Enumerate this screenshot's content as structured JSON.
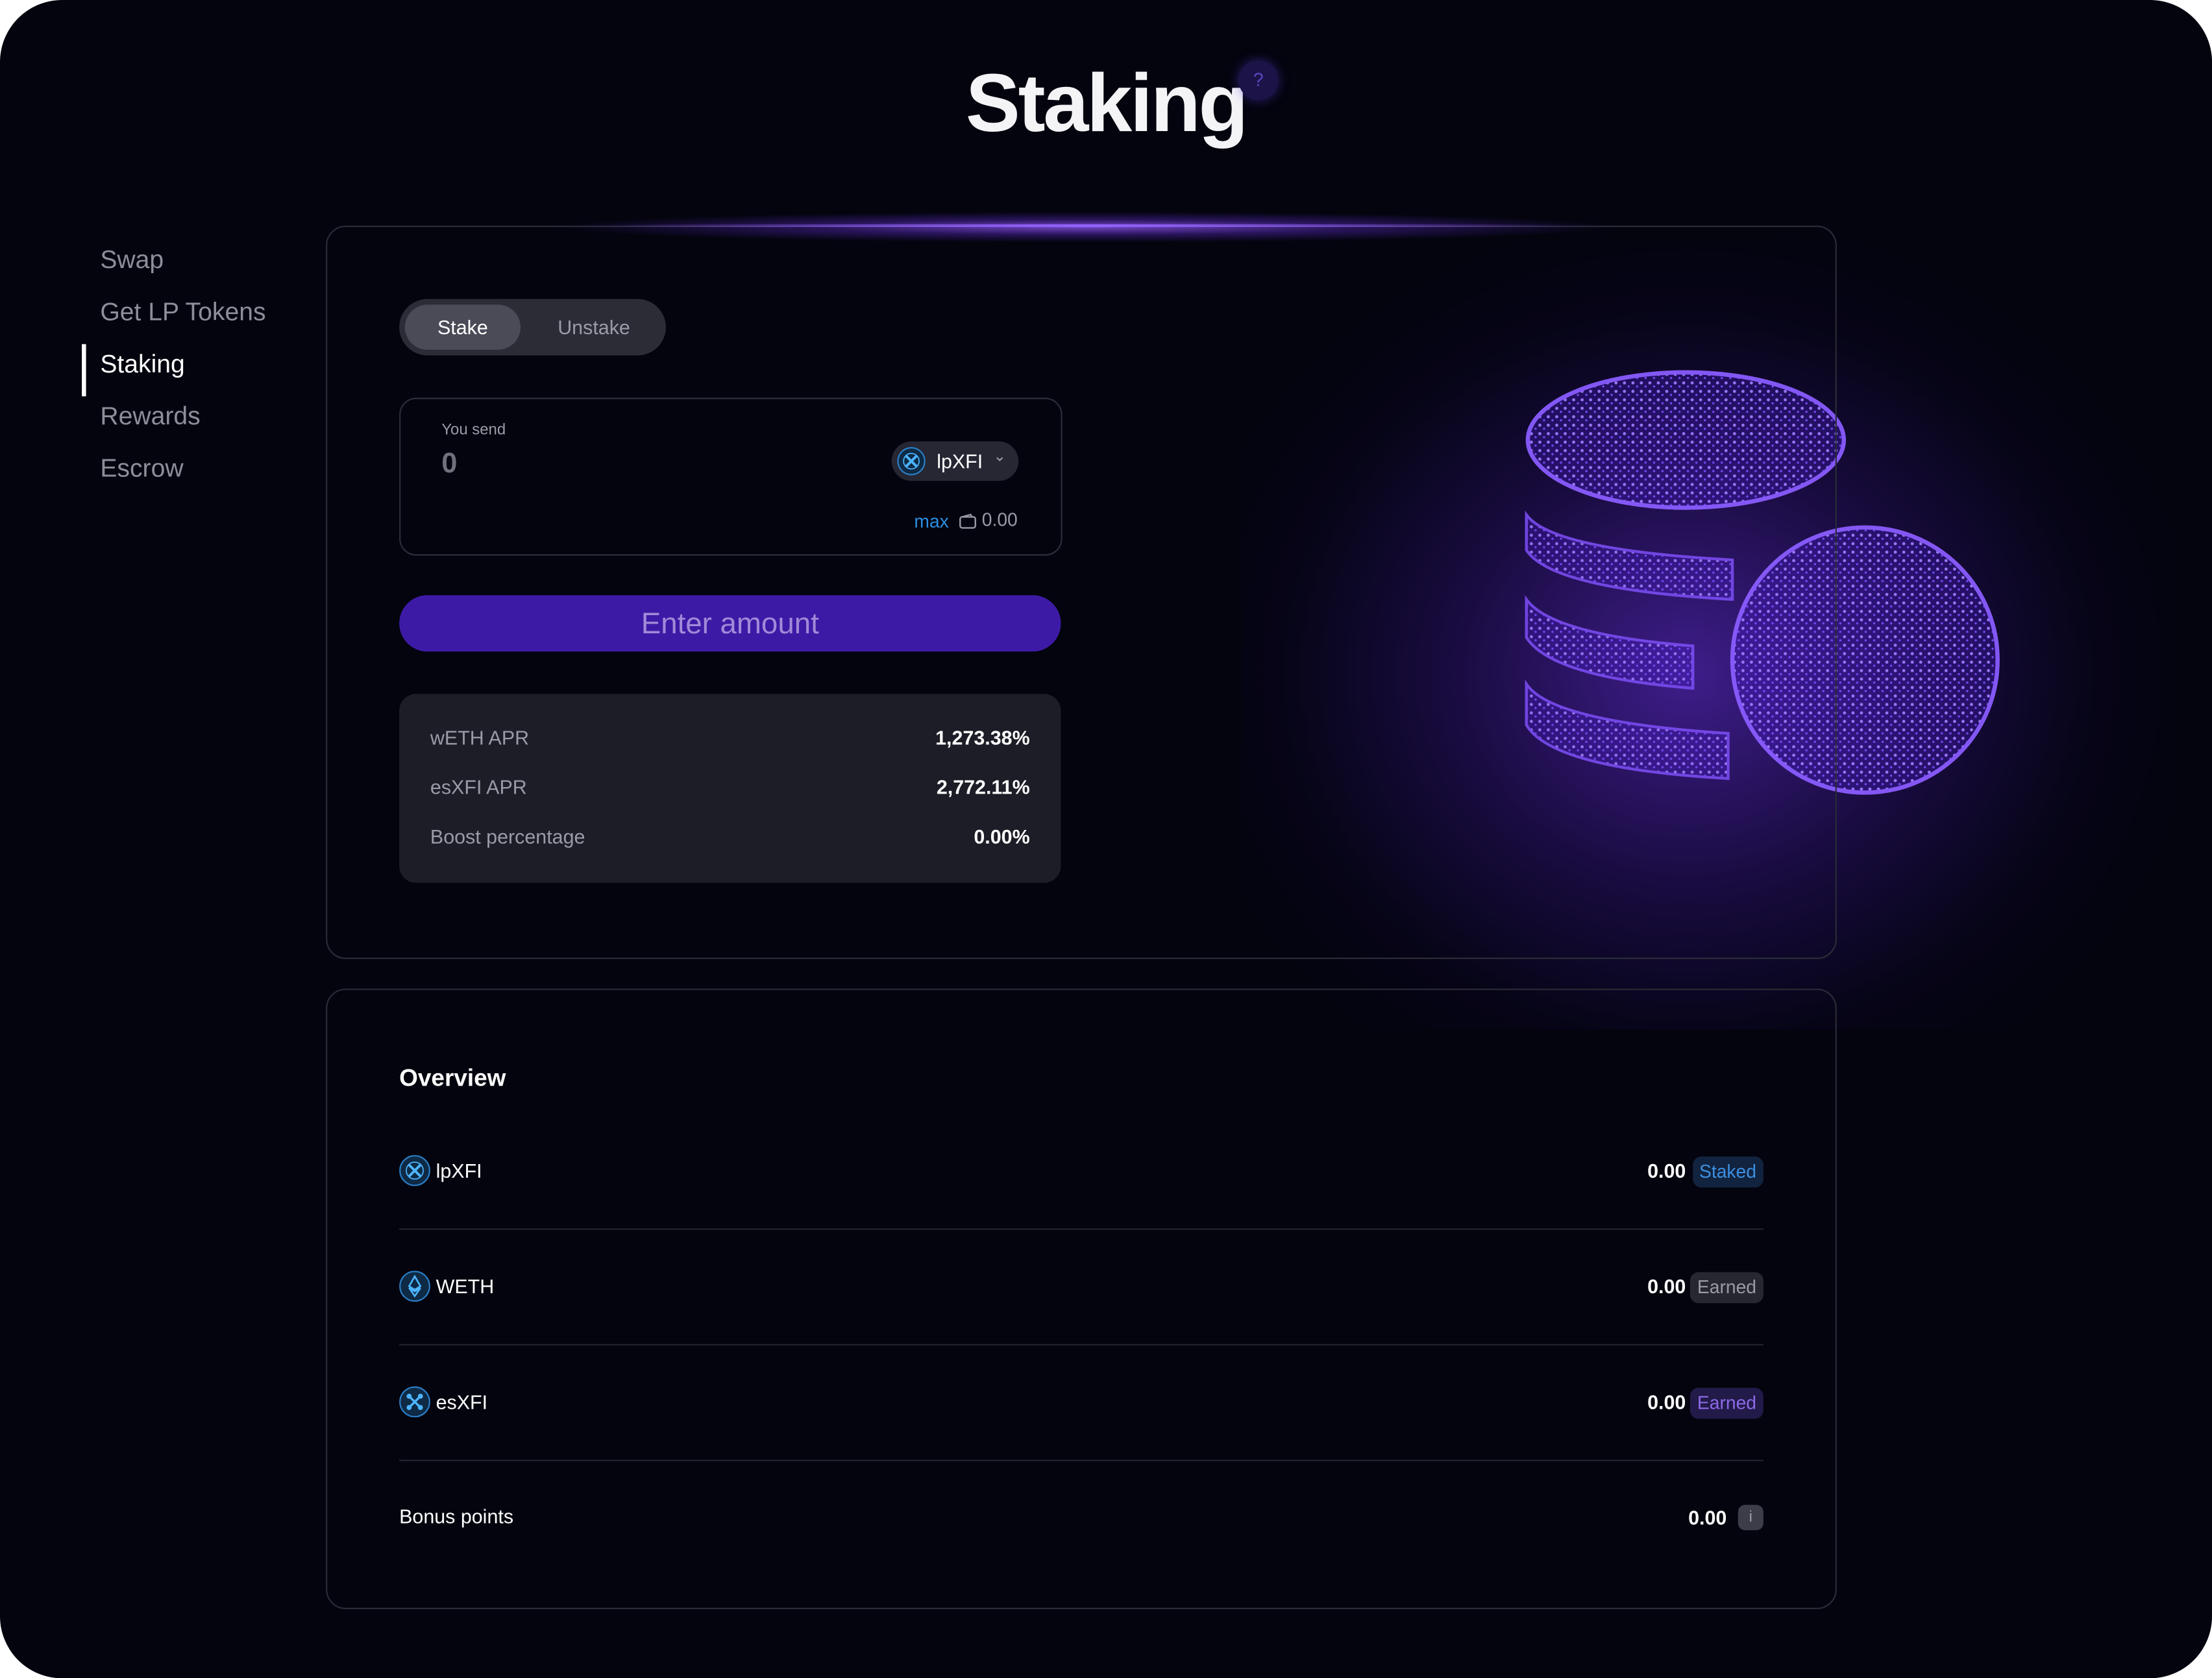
{
  "page": {
    "title": "Staking",
    "help_icon": "?"
  },
  "sidebar": {
    "items": [
      {
        "label": "Swap"
      },
      {
        "label": "Get LP Tokens"
      },
      {
        "label": "Staking",
        "active": true
      },
      {
        "label": "Rewards"
      },
      {
        "label": "Escrow"
      }
    ]
  },
  "stake_panel": {
    "tabs": {
      "stake": "Stake",
      "unstake": "Unstake",
      "selected": "Stake"
    },
    "send": {
      "label": "You send",
      "value": "",
      "placeholder": "0",
      "token": "lpXFI",
      "max_label": "max",
      "balance": "0.00"
    },
    "submit_label": "Enter amount",
    "stats": [
      {
        "label": "wETH APR",
        "value": "1,273.38%"
      },
      {
        "label": "esXFI APR",
        "value": "2,772.11%"
      },
      {
        "label": "Boost percentage",
        "value": "0.00%"
      }
    ]
  },
  "overview": {
    "title": "Overview",
    "rows": [
      {
        "token": "lpXFI",
        "amount": "0.00",
        "badge": "Staked"
      },
      {
        "token": "WETH",
        "amount": "0.00",
        "badge": "Earned"
      },
      {
        "token": "esXFI",
        "amount": "0.00",
        "badge": "Earned"
      }
    ],
    "bonus": {
      "label": "Bonus points",
      "value": "0.00",
      "info_icon": "i"
    }
  },
  "colors": {
    "background": "#03040e",
    "accent": "#3d1aa6",
    "link": "#2a8de0",
    "staked_badge": "#3d8fe0",
    "earned_purple": "#8d6ae8"
  },
  "icons": [
    "help-icon",
    "xfi-token-icon",
    "chevron-down-icon",
    "wallet-icon",
    "eth-token-icon",
    "esxfi-token-icon",
    "info-icon",
    "coin-stack-illustration"
  ]
}
